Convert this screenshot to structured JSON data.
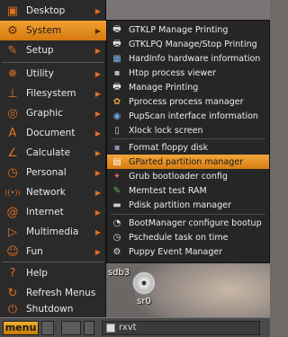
{
  "main_menu": {
    "items": [
      {
        "label": "Desktop",
        "icon": "desktop-icon",
        "glyph": "▣",
        "submenu": true
      },
      {
        "label": "System",
        "icon": "system-gear-icon",
        "glyph": "⚙",
        "submenu": true,
        "active": true
      },
      {
        "label": "Setup",
        "icon": "setup-wrench-icon",
        "glyph": "✎",
        "submenu": true
      },
      {
        "label": "Utility",
        "icon": "utility-icon",
        "glyph": "✵",
        "submenu": true
      },
      {
        "label": "Filesystem",
        "icon": "filesystem-icon",
        "glyph": "⊥",
        "submenu": true
      },
      {
        "label": "Graphic",
        "icon": "graphic-icon",
        "glyph": "◎",
        "submenu": true
      },
      {
        "label": "Document",
        "icon": "document-icon",
        "glyph": "A",
        "submenu": true
      },
      {
        "label": "Calculate",
        "icon": "calculate-icon",
        "glyph": "∠",
        "submenu": true
      },
      {
        "label": "Personal",
        "icon": "personal-clock-icon",
        "glyph": "◷",
        "submenu": true
      },
      {
        "label": "Network",
        "icon": "network-icon",
        "glyph": "((•))",
        "submenu": true
      },
      {
        "label": "Internet",
        "icon": "internet-at-icon",
        "glyph": "@",
        "submenu": true
      },
      {
        "label": "Multimedia",
        "icon": "multimedia-play-icon",
        "glyph": "▷",
        "submenu": true
      },
      {
        "label": "Fun",
        "icon": "fun-smiley-icon",
        "glyph": "☺",
        "submenu": true
      },
      {
        "label": "Help",
        "icon": "help-icon",
        "glyph": "?",
        "submenu": false
      },
      {
        "label": "Refresh Menus",
        "icon": "refresh-icon",
        "glyph": "↻",
        "submenu": false
      },
      {
        "label": "Shutdown",
        "icon": "shutdown-icon",
        "glyph": "⏻",
        "submenu": false
      }
    ]
  },
  "system_submenu": {
    "items": [
      {
        "label": "GTKLP Manage Printing",
        "icon": "printer-icon",
        "glyph": "🖶",
        "color": "#dddddd"
      },
      {
        "label": "GTKLPQ Manage/Stop Printing",
        "icon": "printer-icon",
        "glyph": "🖶",
        "color": "#dddddd"
      },
      {
        "label": "HardInfo hardware information",
        "icon": "chip-icon",
        "glyph": "▦",
        "color": "#7fb0e0"
      },
      {
        "label": "Htop process viewer",
        "icon": "terminal-icon",
        "glyph": "▪",
        "color": "#bbbbbb"
      },
      {
        "label": "Manage Printing",
        "icon": "printer-icon",
        "glyph": "🖶",
        "color": "#dddddd"
      },
      {
        "label": "Pprocess process manager",
        "icon": "process-icon",
        "glyph": "✿",
        "color": "#e0a040"
      },
      {
        "label": "PupScan interface information",
        "icon": "scan-icon",
        "glyph": "◉",
        "color": "#6fa0e0"
      },
      {
        "label": "Xlock lock screen",
        "icon": "lock-icon",
        "glyph": "▯",
        "color": "#cccccc"
      },
      {
        "label": "Format floppy disk",
        "icon": "floppy-icon",
        "glyph": "▪",
        "color": "#9090b0"
      },
      {
        "label": "GParted partition manager",
        "icon": "partition-icon",
        "glyph": "▤",
        "color": "#fafafa",
        "active": true
      },
      {
        "label": "Grub bootloader config",
        "icon": "grub-icon",
        "glyph": "✦",
        "color": "#e06060"
      },
      {
        "label": "Memtest test RAM",
        "icon": "memtest-icon",
        "glyph": "✎",
        "color": "#50c050"
      },
      {
        "label": "Pdisk partition manager",
        "icon": "disk-icon",
        "glyph": "▬",
        "color": "#cccccc"
      },
      {
        "label": "BootManager configure bootup",
        "icon": "bootmanager-icon",
        "glyph": "◔",
        "color": "#dddddd"
      },
      {
        "label": "Pschedule task on time",
        "icon": "schedule-clock-icon",
        "glyph": "◷",
        "color": "#dddddd"
      },
      {
        "label": "Puppy Event Manager",
        "icon": "event-manager-icon",
        "glyph": "⚙",
        "color": "#dddddd"
      }
    ]
  },
  "desktop": {
    "icons": [
      {
        "label": "sdb3",
        "icon": "drive-icon"
      },
      {
        "label": "sr0",
        "icon": "cdrom-icon"
      }
    ]
  },
  "taskbar": {
    "menu_label": "menu",
    "task_label": "rxvt"
  },
  "colors": {
    "accent": "#e07020",
    "menu_bg": "#2a2a2a",
    "highlight": "#e8901f"
  }
}
